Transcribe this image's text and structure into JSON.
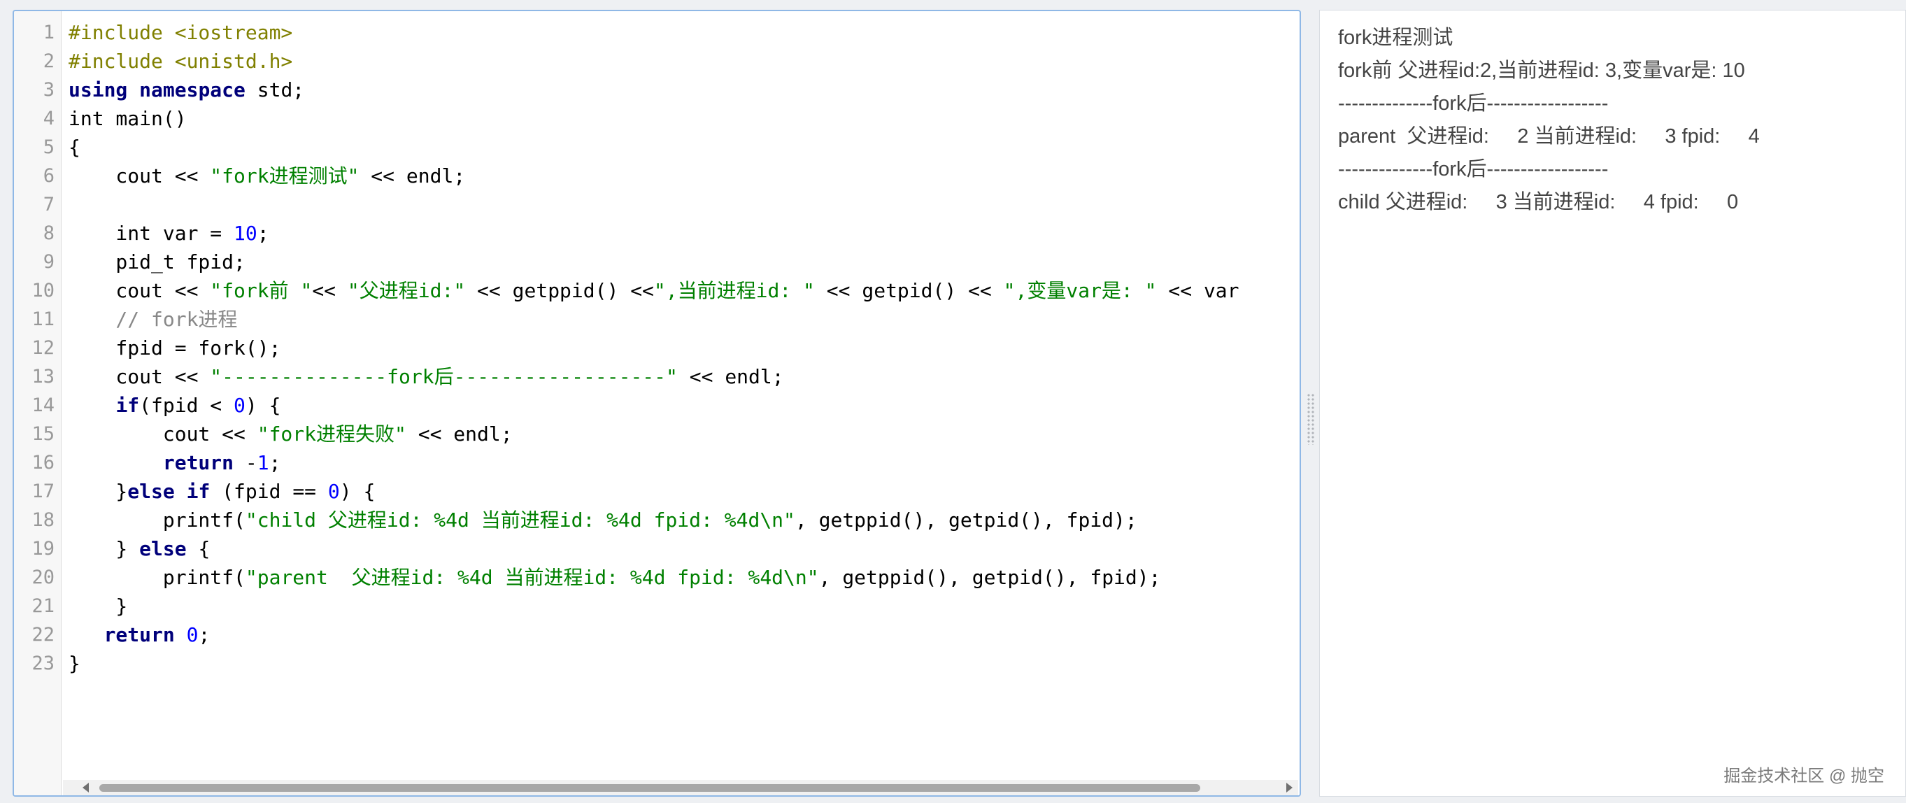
{
  "editor": {
    "lines": [
      {
        "n": "1",
        "tokens": [
          {
            "t": "pre",
            "v": "#include <iostream>"
          }
        ]
      },
      {
        "n": "2",
        "tokens": [
          {
            "t": "pre",
            "v": "#include <unistd.h>"
          }
        ]
      },
      {
        "n": "3",
        "tokens": [
          {
            "t": "kw",
            "v": "using"
          },
          {
            "t": "plain",
            "v": " "
          },
          {
            "t": "kw",
            "v": "namespace"
          },
          {
            "t": "plain",
            "v": " std;"
          }
        ]
      },
      {
        "n": "4",
        "tokens": [
          {
            "t": "plain",
            "v": "int main()"
          }
        ]
      },
      {
        "n": "5",
        "tokens": [
          {
            "t": "plain",
            "v": "{"
          }
        ]
      },
      {
        "n": "6",
        "tokens": [
          {
            "t": "plain",
            "v": "    cout << "
          },
          {
            "t": "str",
            "v": "\"fork进程测试\""
          },
          {
            "t": "plain",
            "v": " << endl;"
          }
        ]
      },
      {
        "n": "7",
        "tokens": [
          {
            "t": "plain",
            "v": ""
          }
        ]
      },
      {
        "n": "8",
        "tokens": [
          {
            "t": "plain",
            "v": "    int var = "
          },
          {
            "t": "num",
            "v": "10"
          },
          {
            "t": "plain",
            "v": ";"
          }
        ]
      },
      {
        "n": "9",
        "tokens": [
          {
            "t": "plain",
            "v": "    pid_t fpid;"
          }
        ]
      },
      {
        "n": "10",
        "tokens": [
          {
            "t": "plain",
            "v": "    cout << "
          },
          {
            "t": "str",
            "v": "\"fork前 \""
          },
          {
            "t": "plain",
            "v": "<< "
          },
          {
            "t": "str",
            "v": "\"父进程id:\""
          },
          {
            "t": "plain",
            "v": " << getppid() <<"
          },
          {
            "t": "str",
            "v": "\",当前进程id: \""
          },
          {
            "t": "plain",
            "v": " << getpid() << "
          },
          {
            "t": "str",
            "v": "\",变量var是: \""
          },
          {
            "t": "plain",
            "v": " << var"
          }
        ]
      },
      {
        "n": "11",
        "tokens": [
          {
            "t": "com",
            "v": "    // fork进程"
          }
        ]
      },
      {
        "n": "12",
        "tokens": [
          {
            "t": "plain",
            "v": "    fpid = fork();"
          }
        ]
      },
      {
        "n": "13",
        "tokens": [
          {
            "t": "plain",
            "v": "    cout << "
          },
          {
            "t": "str",
            "v": "\"--------------fork后------------------\""
          },
          {
            "t": "plain",
            "v": " << endl;"
          }
        ]
      },
      {
        "n": "14",
        "tokens": [
          {
            "t": "plain",
            "v": "    "
          },
          {
            "t": "kw",
            "v": "if"
          },
          {
            "t": "plain",
            "v": "(fpid < "
          },
          {
            "t": "num",
            "v": "0"
          },
          {
            "t": "plain",
            "v": ") {"
          }
        ]
      },
      {
        "n": "15",
        "tokens": [
          {
            "t": "plain",
            "v": "        cout << "
          },
          {
            "t": "str",
            "v": "\"fork进程失败\""
          },
          {
            "t": "plain",
            "v": " << endl;"
          }
        ]
      },
      {
        "n": "16",
        "tokens": [
          {
            "t": "plain",
            "v": "        "
          },
          {
            "t": "kw",
            "v": "return"
          },
          {
            "t": "plain",
            "v": " -"
          },
          {
            "t": "num",
            "v": "1"
          },
          {
            "t": "plain",
            "v": ";"
          }
        ]
      },
      {
        "n": "17",
        "tokens": [
          {
            "t": "plain",
            "v": "    }"
          },
          {
            "t": "kw",
            "v": "else if"
          },
          {
            "t": "plain",
            "v": " (fpid == "
          },
          {
            "t": "num",
            "v": "0"
          },
          {
            "t": "plain",
            "v": ") {"
          }
        ]
      },
      {
        "n": "18",
        "tokens": [
          {
            "t": "plain",
            "v": "        printf("
          },
          {
            "t": "str",
            "v": "\"child 父进程id: %4d 当前进程id: %4d fpid: %4d\\n\""
          },
          {
            "t": "plain",
            "v": ", getppid(), getpid(), fpid);"
          }
        ]
      },
      {
        "n": "19",
        "tokens": [
          {
            "t": "plain",
            "v": "    } "
          },
          {
            "t": "kw",
            "v": "else"
          },
          {
            "t": "plain",
            "v": " {"
          }
        ]
      },
      {
        "n": "20",
        "tokens": [
          {
            "t": "plain",
            "v": "        printf("
          },
          {
            "t": "str",
            "v": "\"parent  父进程id: %4d 当前进程id: %4d fpid: %4d\\n\""
          },
          {
            "t": "plain",
            "v": ", getppid(), getpid(), fpid);"
          }
        ]
      },
      {
        "n": "21",
        "tokens": [
          {
            "t": "plain",
            "v": "    }"
          }
        ]
      },
      {
        "n": "22",
        "tokens": [
          {
            "t": "plain",
            "v": "   "
          },
          {
            "t": "kw",
            "v": "return"
          },
          {
            "t": "plain",
            "v": " "
          },
          {
            "t": "num",
            "v": "0"
          },
          {
            "t": "plain",
            "v": ";"
          }
        ]
      },
      {
        "n": "23",
        "tokens": [
          {
            "t": "plain",
            "v": "}"
          }
        ]
      }
    ]
  },
  "output": {
    "lines": [
      "fork进程测试",
      "fork前 父进程id:2,当前进程id: 3,变量var是: 10",
      "--------------fork后------------------",
      "parent  父进程id:     2 当前进程id:     3 fpid:     4",
      "--------------fork后------------------",
      "child 父进程id:     3 当前进程id:     4 fpid:     0"
    ]
  },
  "watermark": "掘金技术社区 @ 抛空",
  "colors": {
    "editor_border": "#8fb8e6",
    "preprocessor": "#808000",
    "keyword": "#00007a",
    "string": "#008000",
    "number": "#0000ff",
    "comment": "#888888"
  }
}
